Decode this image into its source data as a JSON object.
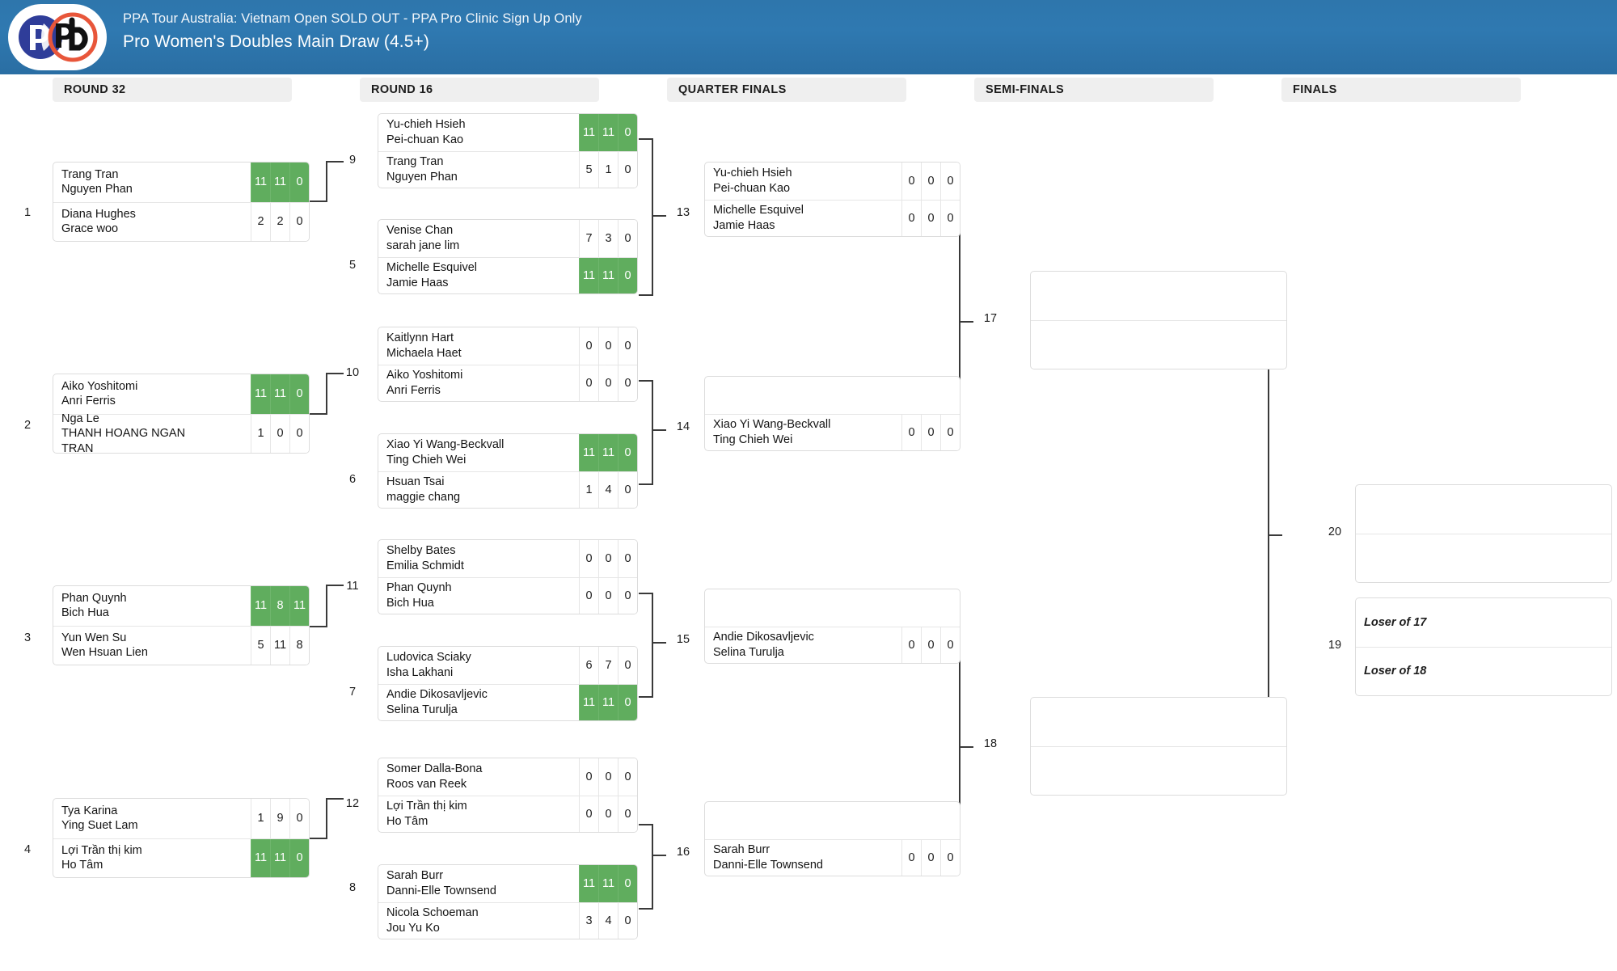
{
  "header": {
    "subtitle": "PPA Tour Australia: Vietnam Open SOLD OUT - PPA Pro Clinic Sign Up Only",
    "title": "Pro Women's Doubles Main Draw (4.5+)",
    "logo_alt": "ppa-pickleball-logo",
    "bg_color": "#2e76ac"
  },
  "colors": {
    "winner_green": "#60ad5e",
    "round_header_bg": "#efefef",
    "connector": "#3a3a3a",
    "box_border": "#dcdcdc"
  },
  "rounds": [
    {
      "label": "ROUND 32"
    },
    {
      "label": "ROUND 16"
    },
    {
      "label": "QUARTER FINALS"
    },
    {
      "label": "SEMI-FINALS"
    },
    {
      "label": "FINALS"
    }
  ],
  "matches": {
    "m1": {
      "number": "1",
      "top": {
        "p1": "Trang Tran",
        "p2": "Nguyen Phan",
        "scores": [
          "11",
          "11",
          "0"
        ],
        "winner": true
      },
      "bottom": {
        "p1": "Diana Hughes",
        "p2": "Grace woo",
        "scores": [
          "2",
          "2",
          "0"
        ],
        "winner": false
      }
    },
    "m2": {
      "number": "2",
      "top": {
        "p1": "Aiko Yoshitomi",
        "p2": "Anri Ferris",
        "scores": [
          "11",
          "11",
          "0"
        ],
        "winner": true
      },
      "bottom": {
        "p1": "Nga Le",
        "p2": "THANH HOANG NGAN",
        "p3": "TRAN",
        "scores": [
          "1",
          "0",
          "0"
        ],
        "winner": false
      }
    },
    "m3": {
      "number": "3",
      "top": {
        "p1": "Phan Quynh",
        "p2": "Bich Hua",
        "scores": [
          "11",
          "8",
          "11"
        ],
        "winner": true
      },
      "bottom": {
        "p1": "Yun Wen Su",
        "p2": "Wen Hsuan Lien",
        "scores": [
          "5",
          "11",
          "8"
        ],
        "winner": false
      }
    },
    "m4": {
      "number": "4",
      "top": {
        "p1": "Tya Karina",
        "p2": "Ying Suet Lam",
        "scores": [
          "1",
          "9",
          "0"
        ],
        "winner": false
      },
      "bottom": {
        "p1": "Lợi Trần thị kim",
        "p2": "Ho Tâm",
        "scores": [
          "11",
          "11",
          "0"
        ],
        "winner": true
      }
    },
    "m5": {
      "number": "5",
      "top": {
        "p1": "Venise Chan",
        "p2": "sarah jane lim",
        "scores": [
          "7",
          "3",
          "0"
        ],
        "winner": false
      },
      "bottom": {
        "p1": "Michelle Esquivel",
        "p2": "Jamie Haas",
        "scores": [
          "11",
          "11",
          "0"
        ],
        "winner": true
      }
    },
    "m6": {
      "number": "6",
      "top": {
        "p1": "Xiao Yi Wang-Beckvall",
        "p2": "Ting Chieh Wei",
        "scores": [
          "11",
          "11",
          "0"
        ],
        "winner": true
      },
      "bottom": {
        "p1": "Hsuan Tsai",
        "p2": "maggie chang",
        "scores": [
          "1",
          "4",
          "0"
        ],
        "winner": false
      }
    },
    "m7": {
      "number": "7",
      "top": {
        "p1": "Ludovica Sciaky",
        "p2": "Isha Lakhani",
        "scores": [
          "6",
          "7",
          "0"
        ],
        "winner": false
      },
      "bottom": {
        "p1": "Andie Dikosavljevic",
        "p2": "Selina Turulja",
        "scores": [
          "11",
          "11",
          "0"
        ],
        "winner": true
      }
    },
    "m8": {
      "number": "8",
      "top": {
        "p1": "Sarah Burr",
        "p2": "Danni-Elle Townsend",
        "scores": [
          "11",
          "11",
          "0"
        ],
        "winner": true
      },
      "bottom": {
        "p1": "Nicola Schoeman",
        "p2": "Jou Yu Ko",
        "scores": [
          "3",
          "4",
          "0"
        ],
        "winner": false
      }
    },
    "m9": {
      "number": "9",
      "top": {
        "p1": "Yu-chieh Hsieh",
        "p2": "Pei-chuan Kao",
        "scores": [
          "11",
          "11",
          "0"
        ],
        "winner": true
      },
      "bottom": {
        "p1": "Trang Tran",
        "p2": "Nguyen Phan",
        "scores": [
          "5",
          "1",
          "0"
        ],
        "winner": false
      }
    },
    "m10": {
      "number": "10",
      "top": {
        "p1": "Kaitlynn Hart",
        "p2": "Michaela Haet",
        "scores": [
          "0",
          "0",
          "0"
        ],
        "winner": false
      },
      "bottom": {
        "p1": "Aiko Yoshitomi",
        "p2": "Anri Ferris",
        "scores": [
          "0",
          "0",
          "0"
        ],
        "winner": false
      }
    },
    "m11": {
      "number": "11",
      "top": {
        "p1": "Shelby Bates",
        "p2": "Emilia Schmidt",
        "scores": [
          "0",
          "0",
          "0"
        ],
        "winner": false
      },
      "bottom": {
        "p1": "Phan Quynh",
        "p2": "Bich Hua",
        "scores": [
          "0",
          "0",
          "0"
        ],
        "winner": false
      }
    },
    "m12": {
      "number": "12",
      "top": {
        "p1": "Somer Dalla-Bona",
        "p2": "Roos van Reek",
        "scores": [
          "0",
          "0",
          "0"
        ],
        "winner": false
      },
      "bottom": {
        "p1": "Lợi Trần thị kim",
        "p2": "Ho Tâm",
        "scores": [
          "0",
          "0",
          "0"
        ],
        "winner": false
      }
    },
    "m13": {
      "number": "13",
      "top": {
        "p1": "Yu-chieh Hsieh",
        "p2": "Pei-chuan Kao",
        "scores": [
          "0",
          "0",
          "0"
        ],
        "winner": false
      },
      "bottom": {
        "p1": "Michelle Esquivel",
        "p2": "Jamie Haas",
        "scores": [
          "0",
          "0",
          "0"
        ],
        "winner": false
      }
    },
    "m14": {
      "number": "14",
      "top": {
        "p1": "",
        "p2": "",
        "empty": true
      },
      "bottom": {
        "p1": "Xiao Yi Wang-Beckvall",
        "p2": "Ting Chieh Wei",
        "scores": [
          "0",
          "0",
          "0"
        ],
        "winner": false
      }
    },
    "m15": {
      "number": "15",
      "top": {
        "p1": "",
        "p2": "",
        "empty": true
      },
      "bottom": {
        "p1": "Andie Dikosavljevic",
        "p2": "Selina Turulja",
        "scores": [
          "0",
          "0",
          "0"
        ],
        "winner": false
      }
    },
    "m16": {
      "number": "16",
      "top": {
        "p1": "",
        "p2": "",
        "empty": true
      },
      "bottom": {
        "p1": "Sarah Burr",
        "p2": "Danni-Elle Townsend",
        "scores": [
          "0",
          "0",
          "0"
        ],
        "winner": false
      }
    },
    "m17": {
      "number": "17",
      "top": {
        "p1": "",
        "p2": "",
        "empty": true
      },
      "bottom": {
        "p1": "",
        "p2": "",
        "empty": true
      }
    },
    "m18": {
      "number": "18",
      "top": {
        "p1": "",
        "p2": "",
        "empty": true
      },
      "bottom": {
        "p1": "",
        "p2": "",
        "empty": true
      }
    },
    "m19": {
      "number": "19",
      "top": {
        "p1": "Loser of 17",
        "p2": "",
        "placeholder": true
      },
      "bottom": {
        "p1": "Loser of 18",
        "p2": "",
        "placeholder": true
      }
    },
    "m20": {
      "number": "20",
      "top": {
        "p1": "",
        "p2": "",
        "empty": true
      },
      "bottom": {
        "p1": "",
        "p2": "",
        "empty": true
      }
    }
  }
}
